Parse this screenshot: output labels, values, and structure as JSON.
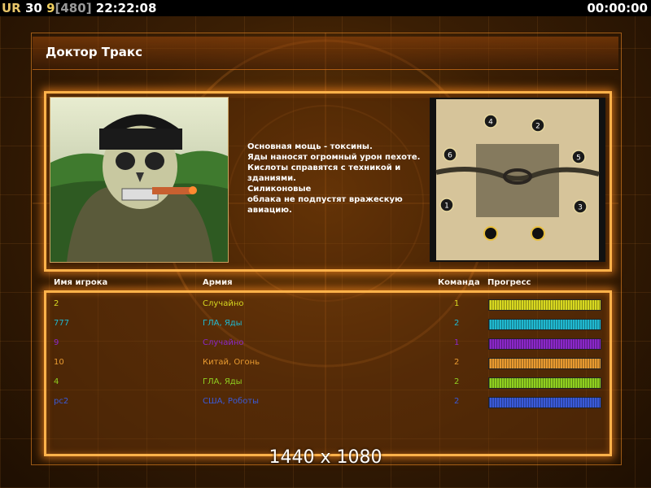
{
  "topbar": {
    "ur": "UR",
    "count": "30",
    "nine": "9",
    "bracket_open": "[",
    "value": "480",
    "bracket_close": "]",
    "clock": "22:22:08",
    "timer": "00:00:00"
  },
  "title": "Доктор Тракс",
  "description": "Основная мощь - токсины.\nЯды наносят огромный урон пехоте.\nКислоты справятся с техникой и\n  зданиями.\nСиликоновые\nоблака не подпустят вражескую\n авиацию.",
  "minimap": {
    "slots": [
      "4",
      "2",
      "6",
      "5",
      "1",
      "3"
    ]
  },
  "table": {
    "headers": {
      "player": "Имя игрока",
      "army": "Армия",
      "team": "Команда",
      "progress": "Прогресс"
    },
    "rows": [
      {
        "name": "2",
        "army": "Случайно",
        "team": "1",
        "color": "#d8d820",
        "progress": 1.0
      },
      {
        "name": "777",
        "army": "ГЛА, Яды",
        "team": "2",
        "color": "#20b8d0",
        "progress": 1.0
      },
      {
        "name": "9",
        "army": "Случайно",
        "team": "1",
        "color": "#8a28c8",
        "progress": 1.0
      },
      {
        "name": "10",
        "army": "Китай, Огонь",
        "team": "2",
        "color": "#e89a30",
        "progress": 1.0
      },
      {
        "name": "4",
        "army": "ГЛА, Яды",
        "team": "2",
        "color": "#90d020",
        "progress": 1.0
      },
      {
        "name": "pc2",
        "army": "США, Роботы",
        "team": "2",
        "color": "#3a5ad8",
        "progress": 1.0
      }
    ]
  },
  "resolution": "1440 x 1080"
}
